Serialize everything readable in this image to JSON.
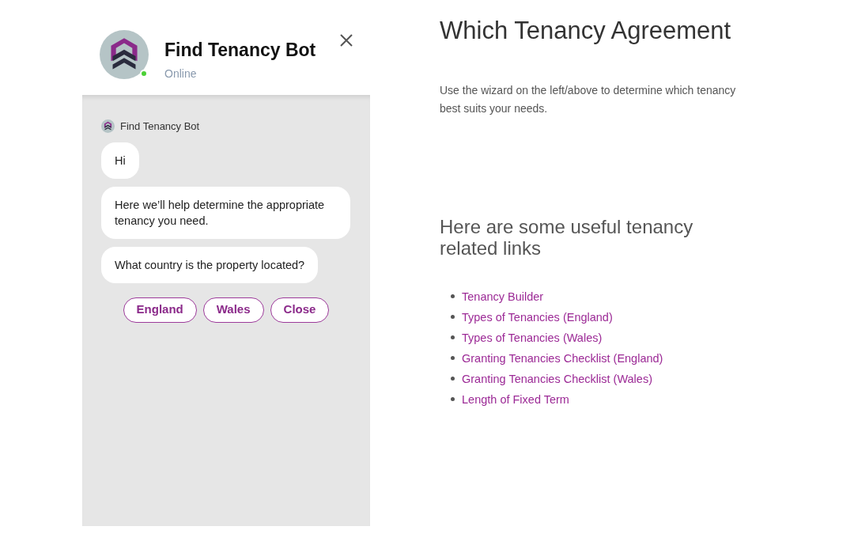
{
  "chat": {
    "title": "Find Tenancy Bot",
    "status": {
      "label": "Online",
      "online": true
    },
    "sender": "Find Tenancy Bot",
    "messages": [
      "Hi",
      "Here we’ll help determine the appropriate tenancy you need.",
      "What country is the property located?"
    ],
    "options": [
      "England",
      "Wales",
      "Close"
    ]
  },
  "info": {
    "title": "Which Tenancy Agreement",
    "description": "Use the wizard on the left/above to determine which tenancy best suits your needs.",
    "links_heading": "Here are some useful tenancy related links",
    "links": [
      "Tenancy Builder",
      "Types of Tenancies (England)",
      "Types of Tenancies (Wales)",
      "Granting Tenancies Checklist (England)",
      "Granting Tenancies Checklist (Wales)",
      "Length of Fixed Term"
    ]
  }
}
